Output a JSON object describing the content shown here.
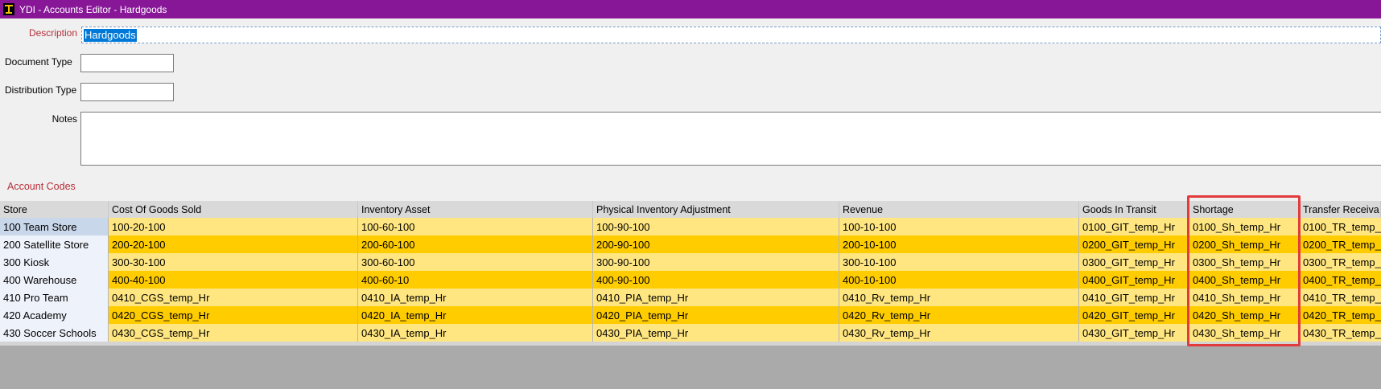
{
  "window": {
    "title": "YDI - Accounts Editor - Hardgoods",
    "icon": "app-logo-icon",
    "title_bar_color": "#881798"
  },
  "form": {
    "description_label": "Description",
    "description_value": "Hardgoods",
    "document_type_label": "Document Type",
    "document_type_value": "",
    "distribution_type_label": "Distribution Type",
    "distribution_type_value": "",
    "notes_label": "Notes",
    "notes_value": ""
  },
  "account_codes": {
    "section_label": "Account Codes",
    "columns": [
      "Store",
      "Cost Of Goods Sold",
      "Inventory Asset",
      "Physical Inventory Adjustment",
      "Revenue",
      "Goods In Transit",
      "Shortage",
      "Transfer Receiva"
    ],
    "rows": [
      [
        "100 Team Store",
        "100-20-100",
        "100-60-100",
        "100-90-100",
        "100-10-100",
        "0100_GIT_temp_Hr",
        "0100_Sh_temp_Hr",
        "0100_TR_temp_"
      ],
      [
        "200 Satellite Store",
        "200-20-100",
        "200-60-100",
        "200-90-100",
        "200-10-100",
        "0200_GIT_temp_Hr",
        "0200_Sh_temp_Hr",
        "0200_TR_temp_"
      ],
      [
        "300 Kiosk",
        "300-30-100",
        "300-60-100",
        "300-90-100",
        "300-10-100",
        "0300_GIT_temp_Hr",
        "0300_Sh_temp_Hr",
        "0300_TR_temp_"
      ],
      [
        "400 Warehouse",
        "400-40-100",
        "400-60-10",
        "400-90-100",
        "400-10-100",
        "0400_GIT_temp_Hr",
        "0400_Sh_temp_Hr",
        "0400_TR_temp_"
      ],
      [
        "410 Pro Team",
        "0410_CGS_temp_Hr",
        "0410_IA_temp_Hr",
        "0410_PIA_temp_Hr",
        "0410_Rv_temp_Hr",
        "0410_GIT_temp_Hr",
        "0410_Sh_temp_Hr",
        "0410_TR_temp_"
      ],
      [
        "420 Academy",
        "0420_CGS_temp_Hr",
        "0420_IA_temp_Hr",
        "0420_PIA_temp_Hr",
        "0420_Rv_temp_Hr",
        "0420_GIT_temp_Hr",
        "0420_Sh_temp_Hr",
        "0420_TR_temp_"
      ],
      [
        "430 Soccer Schools",
        "0430_CGS_temp_Hr",
        "0430_IA_temp_Hr",
        "0430_PIA_temp_Hr",
        "0430_Rv_temp_Hr",
        "0430_GIT_temp_Hr",
        "0430_Sh_temp_Hr",
        "0430_TR_temp_"
      ]
    ],
    "row_colors": [
      "#ffe680",
      "#ffcc00"
    ],
    "highlighted_column": "Shortage",
    "highlight_color": "#e23b3b"
  }
}
